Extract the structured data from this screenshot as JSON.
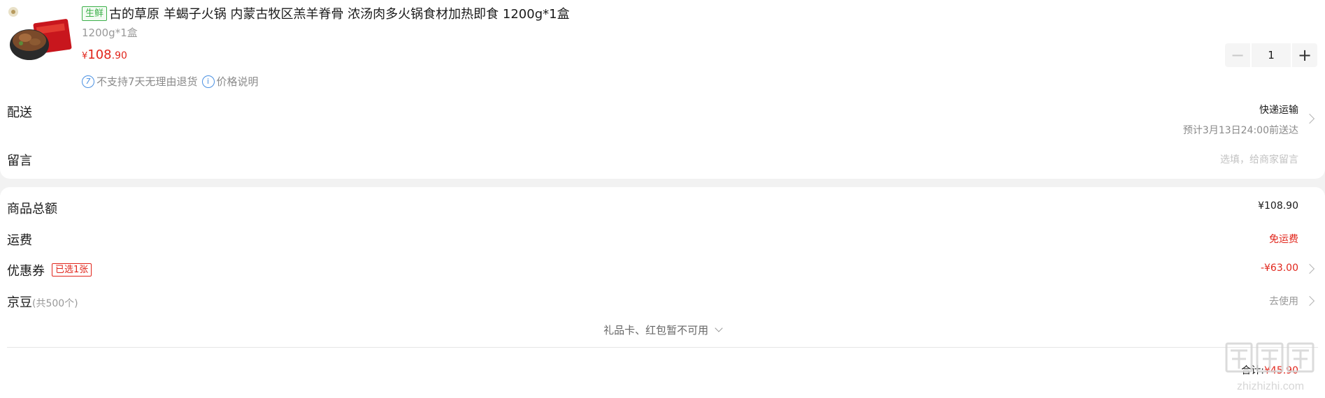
{
  "product": {
    "tag": "生鲜",
    "title": "古的草原 羊蝎子火锅 内蒙古牧区羔羊脊骨 浓汤肉多火锅食材加热即食 1200g*1盒",
    "spec": "1200g*1盒",
    "price_symbol": "¥",
    "price_int": "108",
    "price_dec": ".90",
    "policy_no_return": "不支持7天无理由退货",
    "policy_price_note": "价格说明",
    "quantity": "1"
  },
  "delivery": {
    "label": "配送",
    "method": "快递运输",
    "eta": "预计3月13日24:00前送达"
  },
  "message": {
    "label": "留言",
    "placeholder": "选填，给商家留言"
  },
  "summary": {
    "goods_total_label": "商品总额",
    "goods_total_value": "¥108.90",
    "shipping_label": "运费",
    "shipping_value": "免运费",
    "coupon_label": "优惠券",
    "coupon_tag": "已选1张",
    "coupon_value": "-¥63.00",
    "jingdou_label": "京豆",
    "jingdou_count": "(共500个)",
    "jingdou_action": "去使用",
    "giftcard_note": "礼品卡、红包暂不可用",
    "total_label": "合计:",
    "total_value": "¥45.90"
  },
  "watermark": {
    "text": "zhizhizhi.com"
  },
  "colors": {
    "price_red": "#e1251b",
    "fresh_green": "#3cb04a",
    "info_blue": "#4a90e2"
  }
}
